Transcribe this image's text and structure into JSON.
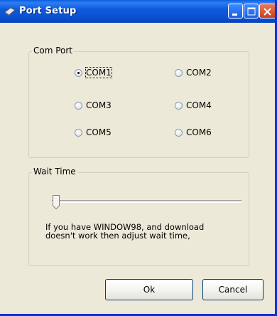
{
  "window": {
    "title": "Port Setup"
  },
  "com_port": {
    "legend": "Com Port",
    "options": [
      {
        "label": "COM1",
        "checked": true
      },
      {
        "label": "COM2",
        "checked": false
      },
      {
        "label": "COM3",
        "checked": false
      },
      {
        "label": "COM4",
        "checked": false
      },
      {
        "label": "COM5",
        "checked": false
      },
      {
        "label": "COM6",
        "checked": false
      }
    ]
  },
  "wait_time": {
    "legend": "Wait Time",
    "slider_value": 0,
    "note": "If you have WINDOW98, and download\ndoesn't work then adjust wait time,"
  },
  "buttons": {
    "ok": "Ok",
    "cancel": "Cancel"
  },
  "colors": {
    "title_bar": "#0a4fd2",
    "dialog_bg": "#ece9d8",
    "close_button": "#c9401c"
  }
}
